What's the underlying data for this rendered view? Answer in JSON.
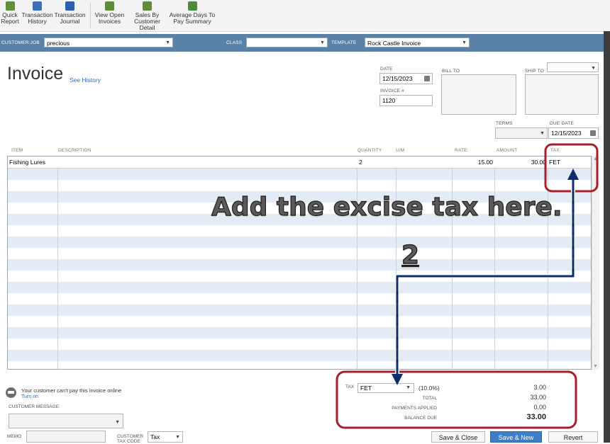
{
  "toolbar": {
    "buttons": [
      {
        "line1": "Quick",
        "line2": "Report",
        "icon": "quick-report-icon",
        "color": "#5f8f3a"
      },
      {
        "line1": "Transaction",
        "line2": "History",
        "icon": "transaction-history-icon",
        "color": "#3e6fb5"
      },
      {
        "line1": "Transaction",
        "line2": "Journal",
        "icon": "transaction-journal-icon",
        "color": "#2e5fa8"
      },
      {
        "line1": "View Open",
        "line2": "Invoices",
        "icon": "view-open-invoices-icon",
        "color": "#5d8a3b"
      },
      {
        "line1": "Sales By",
        "line2": "Customer Detail",
        "icon": "sales-by-customer-icon",
        "color": "#5d8a3b"
      },
      {
        "line1": "Average Days To",
        "line2": "Pay Summary",
        "icon": "average-days-icon",
        "color": "#4c8a3b"
      }
    ]
  },
  "custbar": {
    "customer_label": "CUSTOMER:JOB",
    "customer_value": "precious",
    "class_label": "CLASS",
    "class_value": "",
    "template_label": "TEMPLATE",
    "template_value": "Rock Castle Invoice"
  },
  "header": {
    "title": "Invoice",
    "see_history": "See History",
    "date_label": "DATE",
    "date_value": "12/15/2023",
    "invoice_label": "INVOICE #",
    "invoice_value": "1120",
    "bill_to_label": "BILL TO",
    "ship_to_label": "SHIP TO",
    "terms_label": "TERMS",
    "terms_value": "",
    "due_label": "DUE DATE",
    "due_value": "12/15/2023"
  },
  "grid": {
    "columns": [
      "ITEM",
      "DESCRIPTION",
      "QUANTITY",
      "U/M",
      "RATE",
      "AMOUNT",
      "TAX"
    ],
    "rows": [
      {
        "item": "Fishing Lures",
        "description": "",
        "quantity": "2",
        "um": "",
        "rate": "15.00",
        "amount": "30.00",
        "tax": "FET"
      }
    ]
  },
  "footer": {
    "online_msg": "Your customer can't pay this invoice online",
    "turn_on": "Turn on",
    "customer_message_label": "CUSTOMER MESSAGE",
    "memo_label": "MEMO",
    "customer_tax_code_label_1": "CUSTOMER",
    "customer_tax_code_label_2": "TAX CODE",
    "customer_tax_code_value": "Tax"
  },
  "totals": {
    "tax_label": "TAX",
    "tax_item": "FET",
    "tax_rate": "(10.0%)",
    "tax_amount": "3.00",
    "total_label": "TOTAL",
    "total_value": "33.00",
    "payments_label": "PAYMENTS APPLIED",
    "payments_value": "0.00",
    "balance_label": "BALANCE DUE",
    "balance_value": "33.00"
  },
  "actions": {
    "save_close": "Save & Close",
    "save_new": "Save & New",
    "revert": "Revert"
  },
  "annotation": {
    "callout": "Add the excise tax here.",
    "step": "2",
    "highlight_color": "#a6202a",
    "arrow_color": "#0f2c6b"
  }
}
